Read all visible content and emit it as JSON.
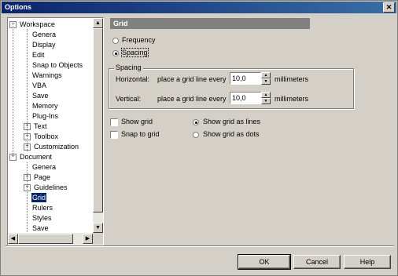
{
  "window": {
    "title": "Options",
    "close_glyph": "✕"
  },
  "tree": {
    "items": [
      {
        "label": "Workspace",
        "level": 0,
        "expander": "−"
      },
      {
        "label": "Genera",
        "level": 1
      },
      {
        "label": "Display",
        "level": 1
      },
      {
        "label": "Edit",
        "level": 1
      },
      {
        "label": "Snap to Objects",
        "level": 1
      },
      {
        "label": "Warnings",
        "level": 1
      },
      {
        "label": "VBA",
        "level": 1
      },
      {
        "label": "Save",
        "level": 1
      },
      {
        "label": "Memory",
        "level": 1
      },
      {
        "label": "Plug-Ins",
        "level": 1
      },
      {
        "label": "Text",
        "level": 1,
        "expander": "+"
      },
      {
        "label": "Toolbox",
        "level": 1,
        "expander": "+"
      },
      {
        "label": "Customization",
        "level": 1,
        "expander": "+"
      },
      {
        "label": "Document",
        "level": 0,
        "expander": "−"
      },
      {
        "label": "Genera",
        "level": 1
      },
      {
        "label": "Page",
        "level": 1,
        "expander": "+"
      },
      {
        "label": "Guidelines",
        "level": 1,
        "expander": "+"
      },
      {
        "label": "Grid",
        "level": 1,
        "selected": true
      },
      {
        "label": "Rulers",
        "level": 1
      },
      {
        "label": "Styles",
        "level": 1
      },
      {
        "label": "Save",
        "level": 1
      }
    ]
  },
  "panel": {
    "title": "Grid",
    "frequency_label": "Frequency",
    "spacing_label": "Spacing",
    "group_title": "Spacing",
    "horizontal": {
      "label": "Horizontal:",
      "prefix": "place a grid line every",
      "value": "10,0",
      "unit": "millimeters"
    },
    "vertical": {
      "label": "Vertical:",
      "prefix": "place a grid line every",
      "value": "10,0",
      "unit": "millimeters"
    },
    "show_grid": "Show grid",
    "snap_to_grid": "Snap to grid",
    "show_as_lines": "Show grid as lines",
    "show_as_dots": "Show grid as dots"
  },
  "buttons": {
    "ok": "OK",
    "cancel": "Cancel",
    "help": "Help"
  },
  "icons": {
    "expand": "plus-box-icon",
    "collapse": "minus-box-icon",
    "scroll_up": "▲",
    "scroll_down": "▼",
    "scroll_left": "◀",
    "scroll_right": "▶"
  }
}
